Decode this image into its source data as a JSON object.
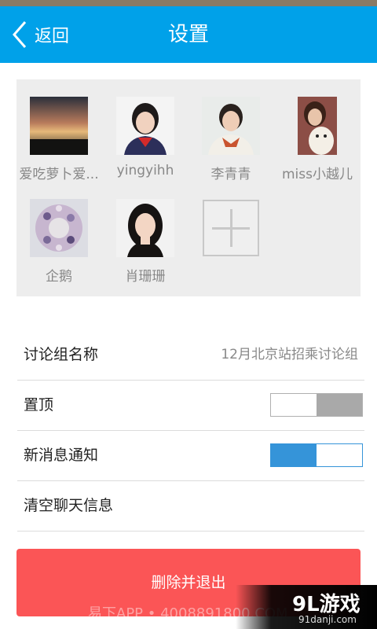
{
  "header": {
    "back_label": "返回",
    "title": "设置",
    "back_icon": "chevron-left-icon",
    "bar_color": "#00a1e9"
  },
  "members": [
    {
      "name": "爱吃萝卜爱..."
    },
    {
      "name": "yingyihh"
    },
    {
      "name": "李青青"
    },
    {
      "name": "miss小越儿"
    },
    {
      "name": "企鹅"
    },
    {
      "name": "肖珊珊"
    }
  ],
  "add_member_icon": "plus-icon",
  "settings": {
    "group_name_label": "讨论组名称",
    "group_name_value": "12月北京站招乘讨论组",
    "pin_label": "置顶",
    "pin_enabled": false,
    "notify_label": "新消息通知",
    "notify_enabled": true,
    "clear_label": "清空聊天信息"
  },
  "delete_button_label": "删除并退出",
  "watermark": {
    "line1": "易下APP • 4008891800.COM",
    "brand": "9L游戏",
    "brand_url": "91danji.com"
  },
  "colors": {
    "toggle_on": "#3594d9",
    "toggle_off": "#a9a9a9",
    "delete": "#fb5556"
  }
}
